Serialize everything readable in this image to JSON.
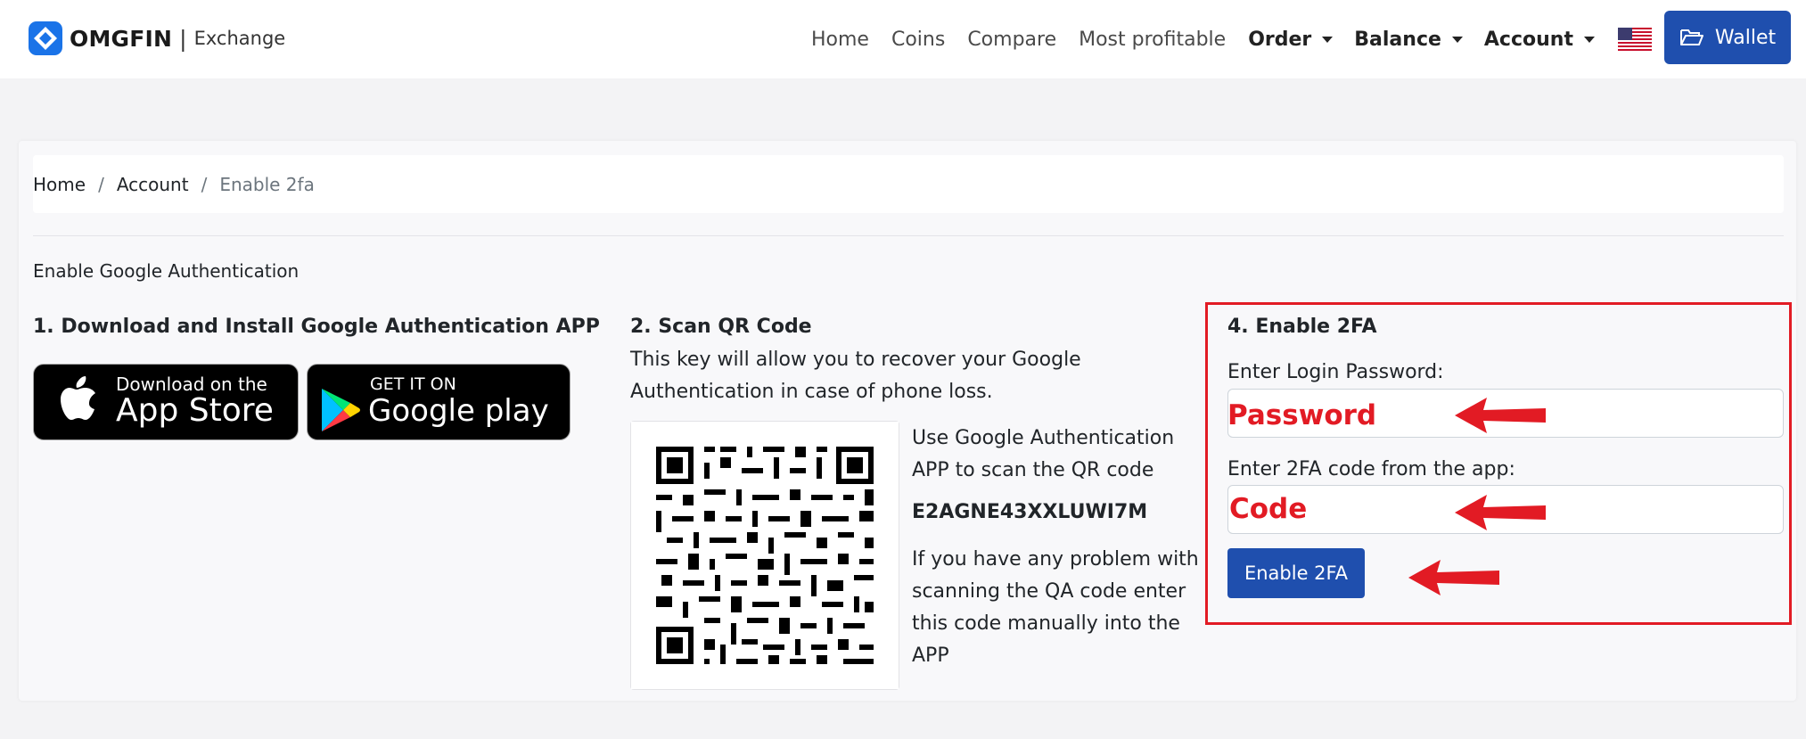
{
  "navbar": {
    "brand_name": "OMGFIN",
    "brand_separator": "|",
    "brand_sub": "Exchange",
    "links": [
      "Home",
      "Coins",
      "Compare",
      "Most profitable"
    ],
    "dropdowns": [
      "Order",
      "Balance",
      "Account"
    ],
    "wallet_label": "Wallet"
  },
  "breadcrumb": {
    "items": [
      "Home",
      "Account"
    ],
    "separator": "/",
    "active": "Enable 2fa"
  },
  "section_title": "Enable Google Authentication",
  "download": {
    "heading": "1. Download and Install Google Authentication APP",
    "app_store_small": "Download on the",
    "app_store_big": "App Store",
    "google_play_small": "GET IT ON",
    "google_play_big": "Google play"
  },
  "scan": {
    "heading": "2. Scan QR Code",
    "description_line1": "This key will allow you to recover your Google",
    "description_line2": "Authentication in case of phone loss.",
    "instruction_line1": "Use Google Authentication",
    "instruction_line2": "APP to scan the QR code",
    "secret_key": "E2AGNE43XXLUWI7M",
    "help_line1": "If you have any problem with",
    "help_line2": "scanning the QA code enter",
    "help_line3": "this code manually into the",
    "help_line4": "APP"
  },
  "enable": {
    "heading": "4. Enable 2FA",
    "password_label": "Enter Login Password:",
    "password_overlay": "Password",
    "code_label": "Enter 2FA code from the app:",
    "code_overlay": "Code",
    "button_label": "Enable 2FA"
  },
  "colors": {
    "primary": "#1f4fae",
    "annotation_red": "#e21b24",
    "brand_blue": "#1a73e8"
  },
  "icons": [
    "omgfin-logo-icon",
    "us-flag-icon",
    "folder-open-icon",
    "apple-icon",
    "google-play-icon",
    "red-arrow-icon"
  ]
}
